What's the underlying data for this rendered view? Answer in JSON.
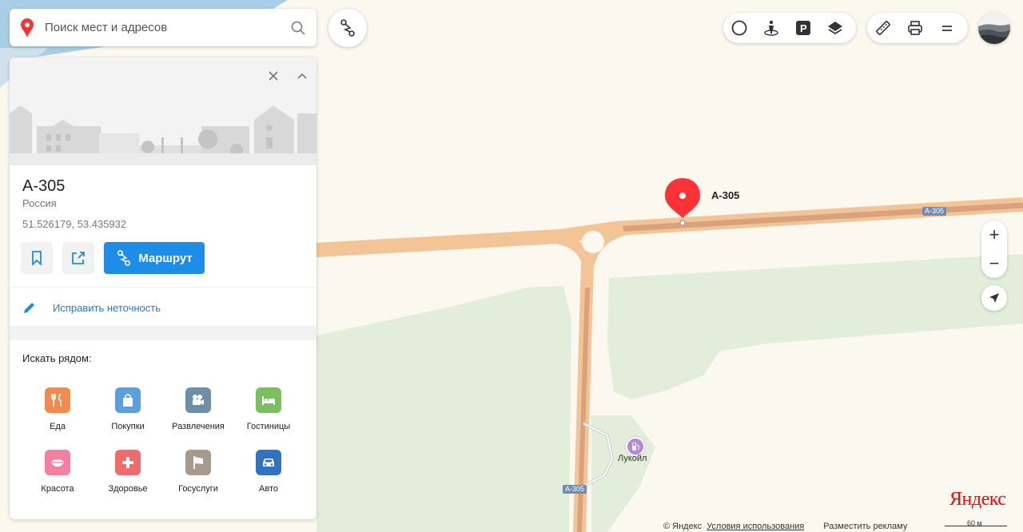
{
  "search": {
    "placeholder": "Поиск мест и адресов"
  },
  "card": {
    "title": "А-305",
    "country": "Россия",
    "coords": "51.526179, 53.435932",
    "route_label": "Маршрут",
    "fix_label": "Исправить неточность",
    "nearby_title": "Искать рядом:",
    "categories": [
      {
        "label": "Еда",
        "color": "#f48a4f",
        "icon": "fork-knife-icon"
      },
      {
        "label": "Покупки",
        "color": "#5aa0e0",
        "icon": "shopping-bag-icon"
      },
      {
        "label": "Развлечения",
        "color": "#6c90a8",
        "icon": "camera-icon"
      },
      {
        "label": "Гостиницы",
        "color": "#7bbf5e",
        "icon": "bed-icon"
      },
      {
        "label": "Красота",
        "color": "#f47fa0",
        "icon": "lips-icon"
      },
      {
        "label": "Здоровье",
        "color": "#f06b6b",
        "icon": "medical-cross-icon"
      },
      {
        "label": "Госуслуги",
        "color": "#a89a8a",
        "icon": "flag-icon"
      },
      {
        "label": "Авто",
        "color": "#2f73c2",
        "icon": "car-icon"
      }
    ]
  },
  "map": {
    "marker_label": "А-305",
    "road_shields": [
      "А-305",
      "А-305"
    ],
    "poi_label": "Лукойл",
    "zoom_in": "+",
    "zoom_out": "−",
    "logo": "Яндекс",
    "copyright": "© Яндекс",
    "terms": "Условия использования",
    "ads": "Разместить рекламу",
    "scale": "60 м"
  },
  "colors": {
    "accent": "#1c8de8",
    "marker": "#ff3333",
    "road": "#f6c48c",
    "green": "#e3eedb"
  }
}
